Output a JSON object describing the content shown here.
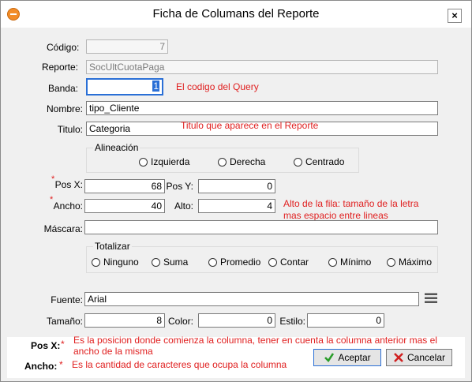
{
  "window": {
    "title": "Ficha de Columans del Reporte",
    "close_glyph": "×"
  },
  "fields": {
    "codigo": {
      "label": "Código:",
      "value": "7"
    },
    "reporte": {
      "label": "Reporte:",
      "value": "SocUltCuotaPaga"
    },
    "banda": {
      "label": "Banda:",
      "value": "1",
      "note": "El codigo del Query"
    },
    "nombre": {
      "label": "Nombre:",
      "value": "tipo_Cliente"
    },
    "titulo": {
      "label": "Titulo:",
      "value": "Categoria",
      "note": "Titulo que aparece en el Reporte"
    },
    "posx": {
      "label": "Pos X:",
      "value": "68"
    },
    "posy": {
      "label": "Pos Y:",
      "value": "0"
    },
    "ancho": {
      "label": "Ancho:",
      "value": "40"
    },
    "alto": {
      "label": "Alto:",
      "value": "4",
      "note_line1": "Alto de la fila: tamaño de la letra",
      "note_line2": "mas espacio entre lineas"
    },
    "mascara": {
      "label": "Máscara:",
      "value": ""
    },
    "fuente": {
      "label": "Fuente:",
      "value": "Arial"
    },
    "tamano": {
      "label": "Tamaño:",
      "value": "8"
    },
    "color": {
      "label": "Color:",
      "value": "0"
    },
    "estilo": {
      "label": "Estilo:",
      "value": "0"
    }
  },
  "required_mark": "*",
  "alineacion": {
    "title": "Alineación",
    "options": [
      "Izquierda",
      "Derecha",
      "Centrado"
    ]
  },
  "totalizar": {
    "title": "Totalizar",
    "options": [
      "Ninguno",
      "Suma",
      "Promedio",
      "Contar",
      "Mínimo",
      "Máximo"
    ]
  },
  "notes": {
    "posx_label": "Pos X:",
    "posx_text1": "Es la posicion donde comienza la columna, tener en cuenta la columna anterior mas el",
    "posx_text2": "ancho de la misma",
    "ancho_label": "Ancho:",
    "ancho_text": "Es la cantidad de caracteres que ocupa la columna"
  },
  "buttons": {
    "aceptar": "Aceptar",
    "cancelar": "Cancelar"
  },
  "colors": {
    "note_red": "#e02020",
    "focus_blue": "#2a6fd6",
    "ok_green": "#2a9d2a",
    "cancel_red": "#d02020"
  }
}
